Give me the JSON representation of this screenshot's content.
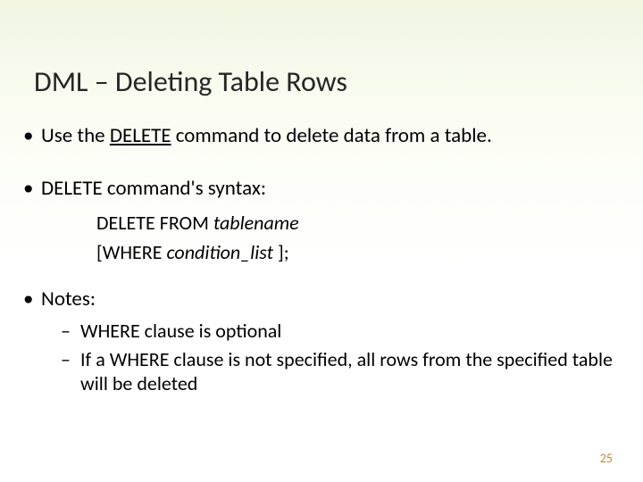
{
  "title": "DML – Deleting Table Rows",
  "bullets": {
    "use_pre": "Use the ",
    "use_keyword": "DELETE",
    "use_post": " command to delete data from a table.",
    "syntax_intro": "DELETE command's syntax:",
    "notes_label": "Notes:"
  },
  "syntax": {
    "line1_pre": "DELETE FROM ",
    "line1_italic": "tablename",
    "line2_pre": "[WHERE ",
    "line2_italic": "condition_list",
    "line2_post": " ];"
  },
  "notes": {
    "n1": "WHERE clause is optional",
    "n2": "If a WHERE clause is not specified, all rows from the specified table will be deleted"
  },
  "page_number": "25"
}
